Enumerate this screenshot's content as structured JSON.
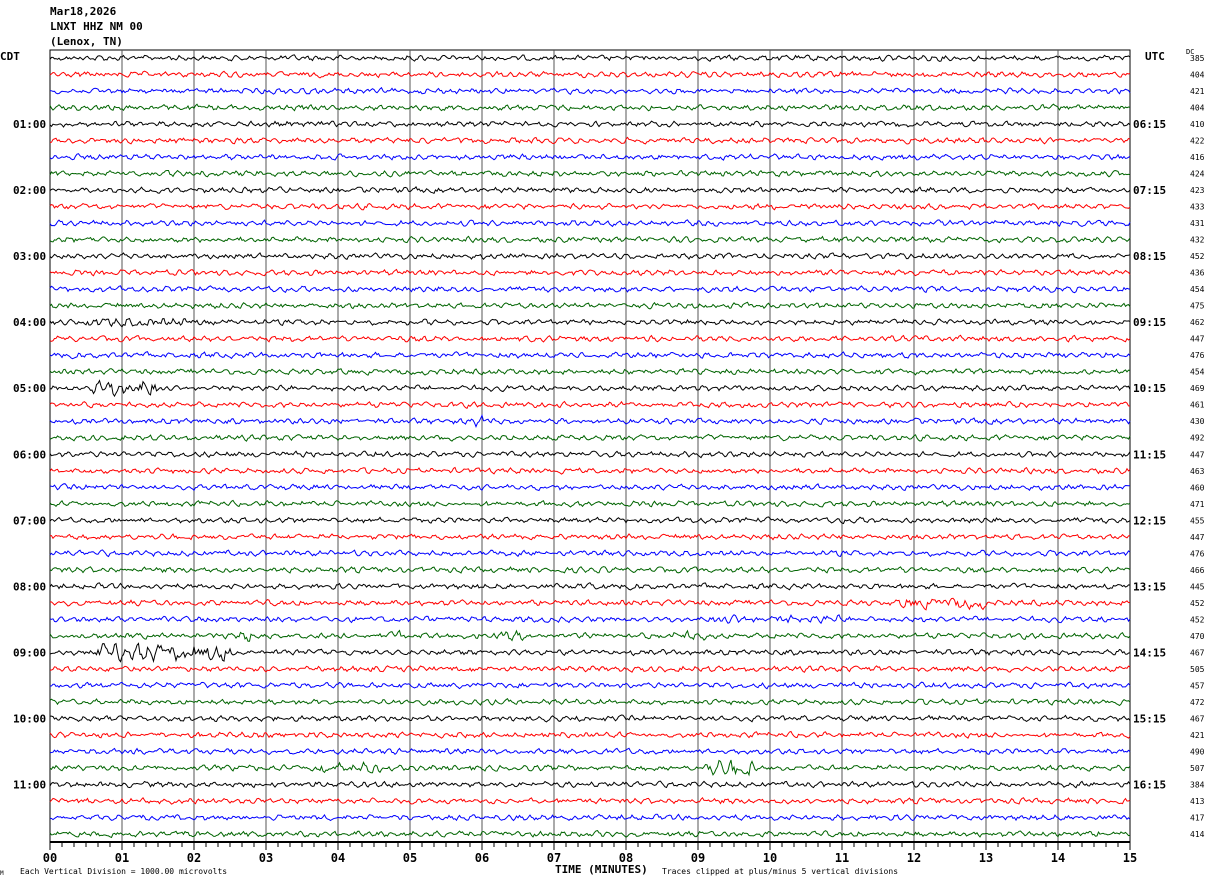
{
  "header": {
    "date": "Mar18,2026",
    "station": "LNXT HHZ NM 00",
    "location": "(Lenox, TN)"
  },
  "left_tz": "CDT",
  "right_tz": "UTC",
  "dc_label": "DC",
  "footer": {
    "scale_note": "Each Vertical Division = 1000.00 microvolts",
    "xlabel": "TIME (MINUTES)",
    "clip_note": "Traces clipped at plus/minus 5 vertical divisions",
    "corner_mark": "M"
  },
  "chart_data": {
    "type": "line",
    "kind": "helicorder",
    "xlabel": "TIME (MINUTES)",
    "xlim": [
      0,
      15
    ],
    "x_ticks": [
      "00",
      "01",
      "02",
      "03",
      "04",
      "05",
      "06",
      "07",
      "08",
      "09",
      "10",
      "11",
      "12",
      "13",
      "14",
      "15"
    ],
    "grid": true,
    "trace_colors": [
      "#000000",
      "#ff0000",
      "#0000ff",
      "#006400"
    ],
    "left_hour_labels": [
      "01:00",
      "02:00",
      "03:00",
      "04:00",
      "05:00",
      "06:00",
      "07:00",
      "08:00",
      "09:00",
      "10:00",
      "11:00"
    ],
    "right_hour_labels": [
      "06:15",
      "07:15",
      "08:15",
      "09:15",
      "10:15",
      "11:15",
      "12:15",
      "13:15",
      "14:15",
      "15:15",
      "16:15"
    ],
    "dc_offsets": [
      385,
      404,
      421,
      404,
      410,
      422,
      416,
      424,
      423,
      433,
      431,
      432,
      452,
      436,
      454,
      475,
      462,
      447,
      476,
      454,
      469,
      461,
      430,
      492,
      447,
      463,
      460,
      471,
      455,
      447,
      476,
      466,
      445,
      452,
      452,
      470,
      467,
      505,
      457,
      472,
      467,
      421,
      490,
      507,
      384,
      413,
      417,
      414
    ]
  }
}
